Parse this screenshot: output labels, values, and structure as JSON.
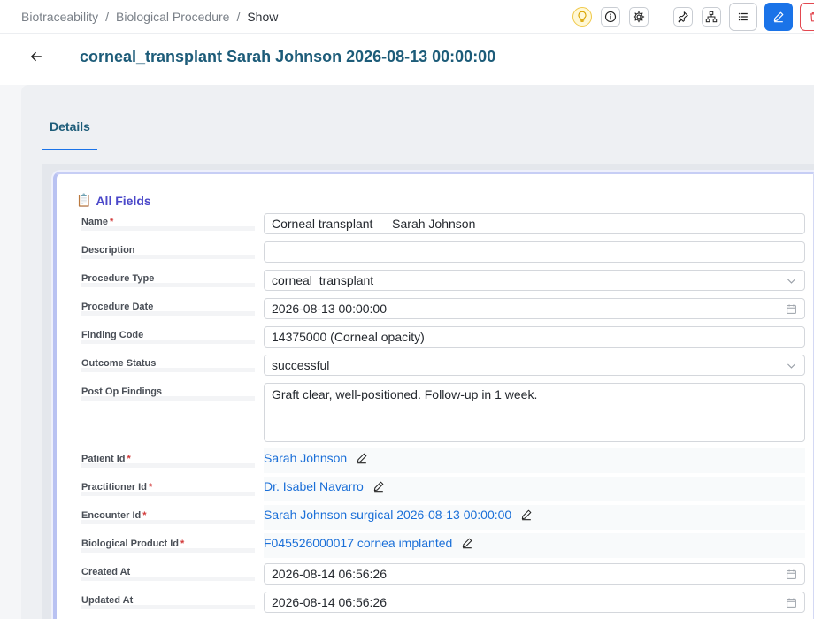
{
  "breadcrumb": [
    "Biotraceability",
    "Biological Procedure",
    "Show"
  ],
  "toolbar": {
    "icons": [
      "lightbulb-icon",
      "info-icon",
      "gear-icon",
      "pin-icon",
      "hierarchy-icon",
      "list-icon",
      "edit-icon",
      "trash-icon"
    ]
  },
  "page": {
    "title": "corneal_transplant Sarah Johnson 2026-08-13 00:00:00"
  },
  "tabs": [
    {
      "label": "Details",
      "active": true
    }
  ],
  "section": {
    "icon": "📋",
    "title": "All Fields"
  },
  "fields": {
    "name": {
      "label": "Name",
      "required": "*",
      "value": "Corneal transplant — Sarah Johnson"
    },
    "description": {
      "label": "Description",
      "value": ""
    },
    "procedure_type": {
      "label": "Procedure Type",
      "value": "corneal_transplant"
    },
    "procedure_date": {
      "label": "Procedure Date",
      "value": "2026-08-13 00:00:00"
    },
    "finding_code": {
      "label": "Finding Code",
      "value": "14375000 (Corneal opacity)"
    },
    "outcome_status": {
      "label": "Outcome Status",
      "value": "successful"
    },
    "post_op_findings": {
      "label": "Post Op Findings",
      "value": "Graft clear, well-positioned. Follow-up in 1 week."
    },
    "patient_id": {
      "label": "Patient Id",
      "required": "*",
      "value": "Sarah Johnson"
    },
    "practitioner_id": {
      "label": "Practitioner Id",
      "required": "*",
      "value": "Dr. Isabel Navarro"
    },
    "encounter_id": {
      "label": "Encounter Id",
      "required": "*",
      "value": "Sarah Johnson surgical 2026-08-13 00:00:00"
    },
    "biological_product_id": {
      "label": "Biological Product Id",
      "required": "*",
      "value": "F045526000017 cornea implanted"
    },
    "created_at": {
      "label": "Created At",
      "value": "2026-08-14 06:56:26"
    },
    "updated_at": {
      "label": "Updated At",
      "value": "2026-08-14 06:56:26"
    }
  },
  "colors": {
    "accent": "#1a73e8",
    "title": "#1d5c79",
    "section": "#4b48c9",
    "link": "#1a6fd8",
    "required": "#d23a3a"
  }
}
